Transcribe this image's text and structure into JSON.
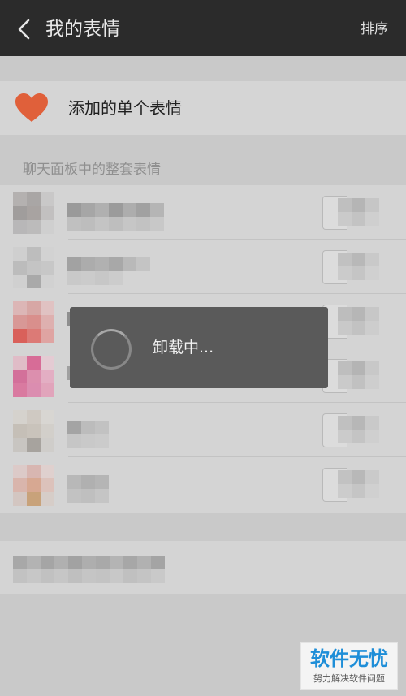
{
  "header": {
    "title": "我的表情",
    "sort_label": "排序"
  },
  "single": {
    "label": "添加的单个表情"
  },
  "section": {
    "label": "聊天面板中的整套表情"
  },
  "toast": {
    "text": "卸载中..."
  },
  "watermark": {
    "title": "软件无忧",
    "subtitle": "努力解决软件问题"
  },
  "colors": {
    "header_bg": "#2b2b2b",
    "heart": "#e0603a",
    "toast_bg": "#5a5a5a",
    "watermark_blue": "#1e8ed8"
  },
  "icons": {
    "back": "chevron-left-icon",
    "heart": "heart-icon",
    "loading": "spinner-icon"
  }
}
